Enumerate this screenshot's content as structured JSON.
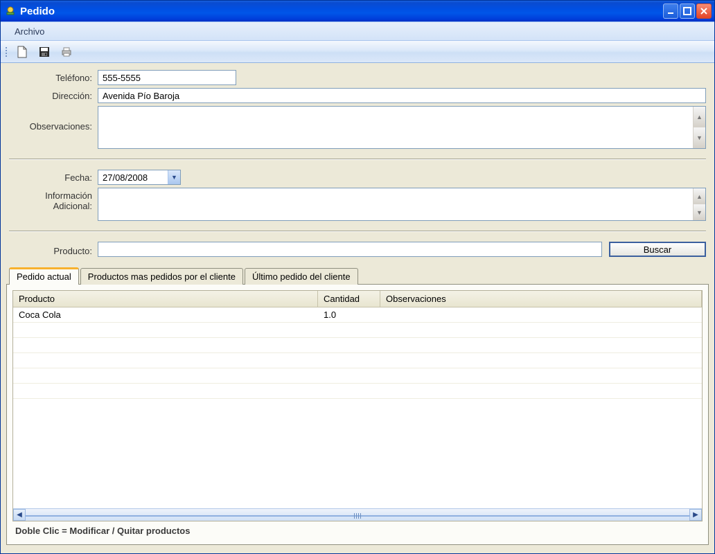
{
  "window": {
    "title": "Pedido"
  },
  "menubar": {
    "archivo": "Archivo"
  },
  "form": {
    "telefono_label": "Teléfono:",
    "telefono_value": "555-5555",
    "direccion_label": "Dirección:",
    "direccion_value": "Avenida Pío Baroja",
    "observaciones_label": "Observaciones:",
    "fecha_label": "Fecha:",
    "fecha_value": "27/08/2008",
    "info_adicional_label_l1": "Información",
    "info_adicional_label_l2": "Adicional:",
    "producto_label": "Producto:",
    "buscar_label": "Buscar"
  },
  "tabs": {
    "items": [
      {
        "label": "Pedido actual"
      },
      {
        "label": "Productos mas pedidos por el cliente"
      },
      {
        "label": "Último pedido del cliente"
      }
    ]
  },
  "grid": {
    "columns": [
      "Producto",
      "Cantidad",
      "Observaciones"
    ],
    "rows": [
      {
        "producto": "Coca Cola",
        "cantidad": "1.0",
        "observaciones": ""
      }
    ],
    "hint": "Doble Clic = Modificar / Quitar productos"
  }
}
